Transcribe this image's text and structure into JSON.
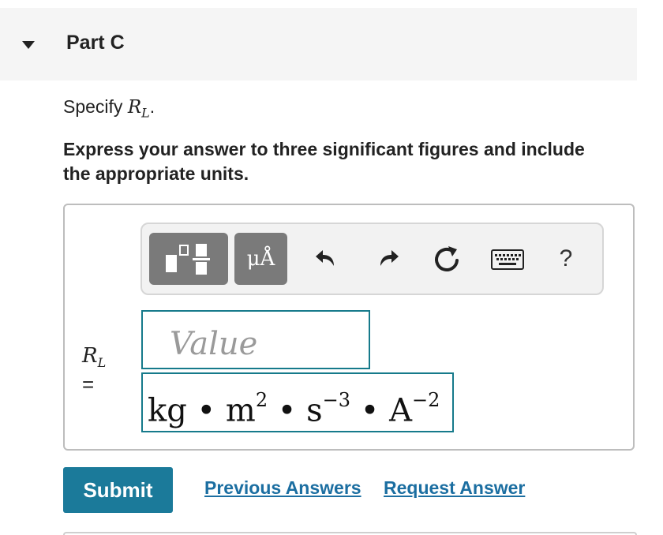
{
  "part": {
    "title": "Part C"
  },
  "question": {
    "specify_prefix": "Specify ",
    "variable_main": "R",
    "variable_sub": "L",
    "specify_suffix": ".",
    "instructions": "Express your answer to three significant figures and include the appropriate units."
  },
  "toolbar": {
    "units_label": "μÅ",
    "help_label": "?",
    "icons": {
      "templates": "templates-icon",
      "undo": "undo-icon",
      "redo": "redo-icon",
      "reset": "reset-icon",
      "keyboard": "keyboard-icon"
    },
    "button_color": "#7a7a7a"
  },
  "answer": {
    "label_main": "R",
    "label_sub": "L",
    "equals": "=",
    "value_placeholder": "Value",
    "units": {
      "u1": "kg",
      "dot1": " • ",
      "u2": "m",
      "e2": "2",
      "dot2": " • ",
      "u3": "s",
      "e3": "−3",
      "dot3": " • ",
      "u4": "A",
      "e4": "−2"
    }
  },
  "actions": {
    "submit_label": "Submit",
    "previous_answers_label": "Previous Answers",
    "request_answer_label": "Request Answer"
  },
  "colors": {
    "accent": "#1b7a9a",
    "link": "#1b6ea1",
    "input_border": "#167a8b"
  }
}
